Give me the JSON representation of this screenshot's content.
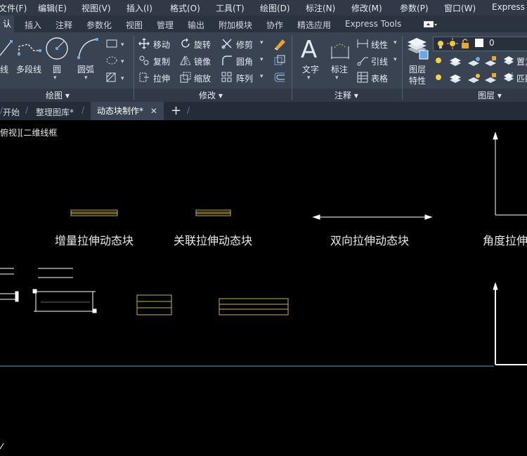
{
  "menubar": {
    "items": [
      "文件(F)",
      "编辑(E)",
      "视图(V)",
      "插入(I)",
      "格式(O)",
      "工具(T)",
      "绘图(D)",
      "标注(N)",
      "修改(M)",
      "参数(P)",
      "窗口(W)",
      "Express"
    ]
  },
  "ribbon_tabs": {
    "active": "认",
    "items": [
      "插入",
      "注释",
      "参数化",
      "视图",
      "管理",
      "输出",
      "附加模块",
      "协作",
      "精选应用",
      "Express Tools"
    ]
  },
  "ribbon": {
    "draw": {
      "line": "线",
      "polyline": "多段线",
      "circle": "圆",
      "arc": "圆弧",
      "panel": "绘图 ▾"
    },
    "modify": {
      "move": "移动",
      "rotate": "旋转",
      "trim": "修剪",
      "copy": "复制",
      "mirror": "镜像",
      "fillet": "圆角",
      "stretch": "拉伸",
      "scale": "缩放",
      "array": "阵列",
      "panel": "修改 ▾"
    },
    "annotation": {
      "text": "文字",
      "dimension": "标注",
      "linear": "线性",
      "leader": "引线",
      "table": "表格",
      "panel": "注释 ▾"
    },
    "layers": {
      "properties_line1": "图层",
      "properties_line2": "特性",
      "current_layer": "0",
      "set_current": "置为",
      "match": "匹配",
      "panel": "图层 ▾"
    }
  },
  "doc_tabs": {
    "items": [
      "开始",
      "整理图库*",
      "动态块制作*"
    ],
    "active_index": 2,
    "close": "✕",
    "add": "+"
  },
  "canvas": {
    "view_label": "俯视][二维线框",
    "labels": [
      "增量拉伸动态块",
      "关联拉伸动态块",
      "双向拉伸动态块",
      "角度拉伸"
    ]
  },
  "colors": {
    "block_yellow": "#c9b24a",
    "canvas": "#000000",
    "ucs_line": "#4aa3c4"
  }
}
